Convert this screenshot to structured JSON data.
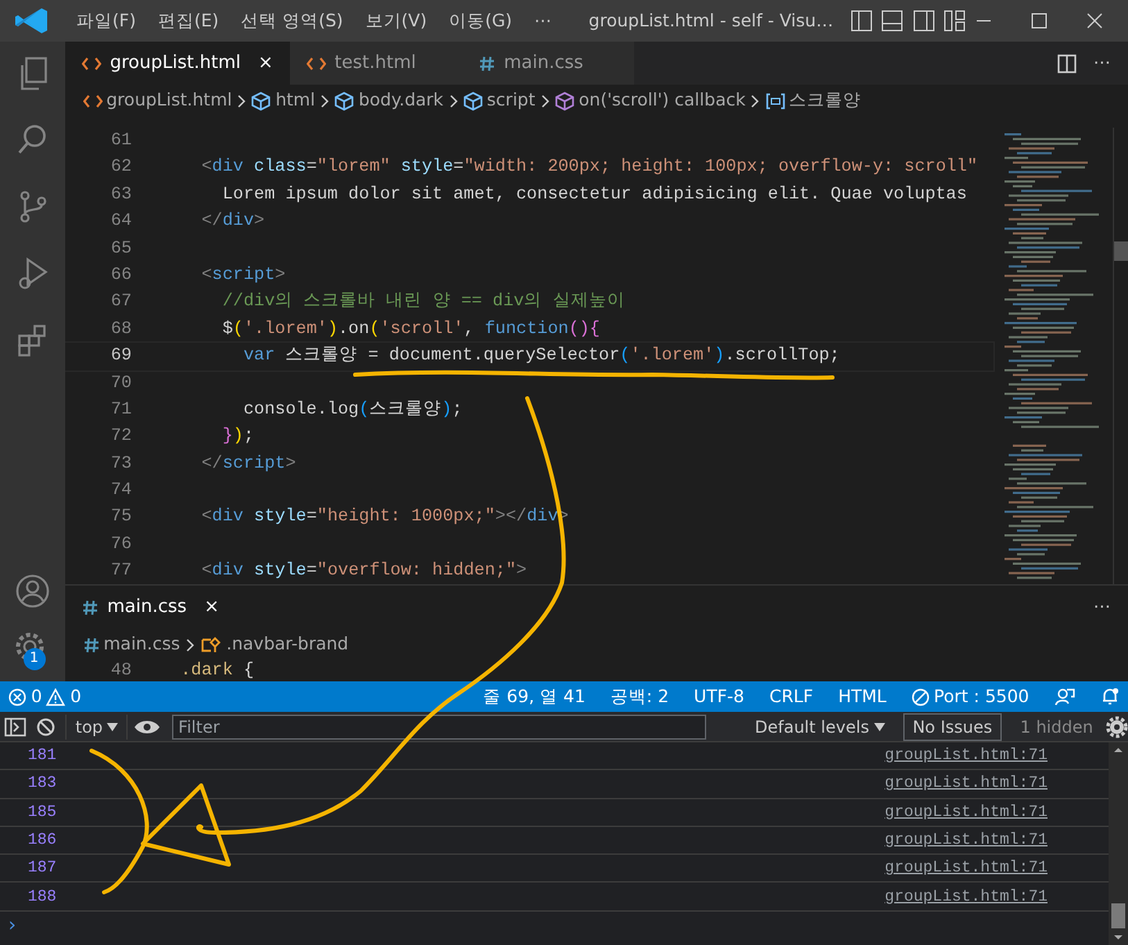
{
  "title_bar": {
    "menus": [
      "파일(F)",
      "편집(E)",
      "선택 영역(S)",
      "보기(V)",
      "이동(G)"
    ],
    "more": "⋯",
    "title": "groupList.html - self - Visu…"
  },
  "activity_bar": {
    "badge": "1"
  },
  "editor_tabs": [
    {
      "label": "groupList.html",
      "kind": "html",
      "selected": true,
      "close": "×"
    },
    {
      "label": "test.html",
      "kind": "html",
      "selected": false
    },
    {
      "label": "main.css",
      "kind": "css",
      "selected": false
    }
  ],
  "breadcrumb": [
    {
      "label": "groupList.html",
      "kind": "file"
    },
    {
      "label": "html",
      "kind": "element"
    },
    {
      "label": "body.dark",
      "kind": "element"
    },
    {
      "label": "script",
      "kind": "element"
    },
    {
      "label": "on('scroll') callback",
      "kind": "function"
    },
    {
      "label": "스크롤양",
      "kind": "variable"
    }
  ],
  "code_lines": [
    {
      "number": "61",
      "current": false
    },
    {
      "number": "62",
      "current": false,
      "tokens": [
        {
          "kind": "punct",
          "text": "    <"
        },
        {
          "kind": "tag",
          "text": "div"
        },
        {
          "kind": "attr",
          "text": " class"
        },
        {
          "kind": "text",
          "text": "="
        },
        {
          "kind": "string",
          "text": "\"lorem\""
        },
        {
          "kind": "attr",
          "text": " style"
        },
        {
          "kind": "text",
          "text": "="
        },
        {
          "kind": "string",
          "text": "\"width: 200px; height: 100px; overflow-y: scroll\""
        }
      ]
    },
    {
      "number": "63",
      "current": false,
      "tokens": [
        {
          "kind": "text",
          "text": "      Lorem ipsum dolor sit amet, consectetur adipisicing elit. Quae voluptas"
        }
      ]
    },
    {
      "number": "64",
      "current": false,
      "tokens": [
        {
          "kind": "punct",
          "text": "    </"
        },
        {
          "kind": "tag",
          "text": "div"
        },
        {
          "kind": "punct",
          "text": ">"
        }
      ]
    },
    {
      "number": "65",
      "current": false
    },
    {
      "number": "66",
      "current": false,
      "tokens": [
        {
          "kind": "punct",
          "text": "    <"
        },
        {
          "kind": "tag",
          "text": "script"
        },
        {
          "kind": "punct",
          "text": ">"
        }
      ]
    },
    {
      "number": "67",
      "current": false,
      "tokens": [
        {
          "kind": "comment",
          "text": "      //div의 스크롤바 내린 양 == div의 실제높이"
        }
      ]
    },
    {
      "number": "68",
      "current": false,
      "tokens": [
        {
          "kind": "text",
          "text": "      $"
        },
        {
          "kind": "bracket",
          "text": "("
        },
        {
          "kind": "string",
          "text": "'.lorem'"
        },
        {
          "kind": "bracket",
          "text": ")"
        },
        {
          "kind": "text",
          "text": ".on"
        },
        {
          "kind": "bracket",
          "text": "("
        },
        {
          "kind": "string",
          "text": "'scroll'"
        },
        {
          "kind": "text",
          "text": ", "
        },
        {
          "kind": "keyword",
          "text": "function"
        },
        {
          "kind": "bracket2",
          "text": "(){"
        }
      ]
    },
    {
      "number": "69",
      "current": true,
      "tokens": [
        {
          "kind": "keyword",
          "text": "        var"
        },
        {
          "kind": "text",
          "text": " 스크롤양 = document.querySelector"
        },
        {
          "kind": "bracket3",
          "text": "("
        },
        {
          "kind": "string",
          "text": "'.lorem'"
        },
        {
          "kind": "bracket3",
          "text": ")"
        },
        {
          "kind": "text",
          "text": ".scrollTop;"
        }
      ]
    },
    {
      "number": "70",
      "current": false
    },
    {
      "number": "71",
      "current": false,
      "tokens": [
        {
          "kind": "text",
          "text": "        console.log"
        },
        {
          "kind": "bracket3",
          "text": "("
        },
        {
          "kind": "text",
          "text": "스크롤양"
        },
        {
          "kind": "bracket3",
          "text": ")"
        },
        {
          "kind": "text",
          "text": ";"
        }
      ]
    },
    {
      "number": "72",
      "current": false,
      "tokens": [
        {
          "kind": "bracket2",
          "text": "      }"
        },
        {
          "kind": "bracket",
          "text": ")"
        },
        {
          "kind": "text",
          "text": ";"
        }
      ]
    },
    {
      "number": "73",
      "current": false,
      "tokens": [
        {
          "kind": "punct",
          "text": "    </"
        },
        {
          "kind": "tag",
          "text": "script"
        },
        {
          "kind": "punct",
          "text": ">"
        }
      ]
    },
    {
      "number": "74",
      "current": false
    },
    {
      "number": "75",
      "current": false,
      "tokens": [
        {
          "kind": "punct",
          "text": "    <"
        },
        {
          "kind": "tag",
          "text": "div"
        },
        {
          "kind": "attr",
          "text": " style"
        },
        {
          "kind": "text",
          "text": "="
        },
        {
          "kind": "string",
          "text": "\"height: 1000px;\""
        },
        {
          "kind": "punct",
          "text": "></"
        },
        {
          "kind": "tag",
          "text": "div"
        },
        {
          "kind": "punct",
          "text": ">"
        }
      ]
    },
    {
      "number": "76",
      "current": false
    },
    {
      "number": "77",
      "current": false,
      "tokens": [
        {
          "kind": "punct",
          "text": "    <"
        },
        {
          "kind": "tag",
          "text": "div"
        },
        {
          "kind": "attr",
          "text": " style"
        },
        {
          "kind": "text",
          "text": "="
        },
        {
          "kind": "string",
          "text": "\"overflow: hidden;\""
        },
        {
          "kind": "punct",
          "text": ">"
        }
      ]
    }
  ],
  "panel": {
    "tab": {
      "label": "main.css",
      "kind": "css",
      "close": "×"
    },
    "more": "⋯",
    "breadcrumb": [
      {
        "label": "main.css",
        "kind": "file"
      },
      {
        "label": ".navbar-brand",
        "kind": "selector"
      }
    ],
    "code_lines": [
      {
        "number": "48",
        "current": false,
        "tokens": [
          {
            "kind": "selector",
            "text": "  .dark "
          },
          {
            "kind": "text",
            "text": "{"
          }
        ]
      }
    ]
  },
  "status_bar": {
    "errors": "0",
    "warnings": "0",
    "items": [
      "줄 69, 열 41",
      "공백: 2",
      "UTF-8",
      "CRLF",
      "HTML"
    ],
    "port": "Port : 5500"
  },
  "console": {
    "context": "top",
    "filter_placeholder": "Filter",
    "levels": "Default levels",
    "issues": "No Issues",
    "hidden": "1 hidden",
    "messages": [
      {
        "value": "181",
        "source": "groupList.html:71"
      },
      {
        "value": "183",
        "source": "groupList.html:71"
      },
      {
        "value": "185",
        "source": "groupList.html:71"
      },
      {
        "value": "186",
        "source": "groupList.html:71"
      },
      {
        "value": "187",
        "source": "groupList.html:71"
      },
      {
        "value": "188",
        "source": "groupList.html:71"
      }
    ],
    "prompt": "›"
  }
}
